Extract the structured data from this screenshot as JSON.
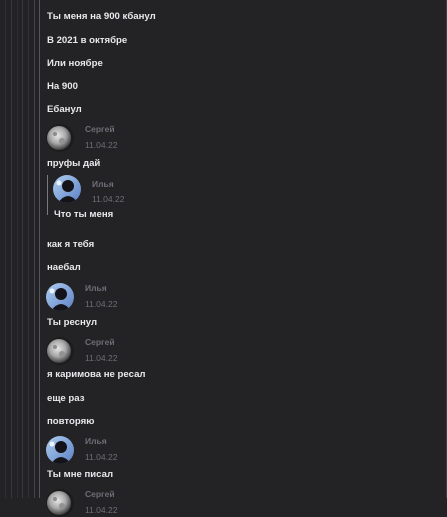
{
  "colors": {
    "background": "#232225",
    "message_text": "#e9e9ec",
    "meta_text": "#6f6e76"
  },
  "messages": [
    {
      "text": "Ты меня на 900 кбанул"
    },
    {
      "text": "В 2021 в октябре"
    },
    {
      "text": "Или ноябре"
    },
    {
      "text": "На 900"
    },
    {
      "text": "Ебанул"
    },
    {
      "author": "Сергей",
      "date": "11.04.22",
      "avatar_icon": "moon-avatar-icon"
    },
    {
      "text": "пруфы дай"
    },
    {
      "quote": {
        "author": "Илья",
        "date": "11.04.22",
        "avatar_icon": "person-avatar-icon",
        "text": "Что ты меня"
      }
    },
    {
      "text": "как я тебя"
    },
    {
      "text": "наебал"
    },
    {
      "author": "Илья",
      "date": "11.04.22",
      "avatar_icon": "person-avatar-icon"
    },
    {
      "text": "Ты реснул"
    },
    {
      "author": "Сергей",
      "date": "11.04.22",
      "avatar_icon": "moon-avatar-icon"
    },
    {
      "text": "я каримова не ресал"
    },
    {
      "text": "еще раз"
    },
    {
      "text": "повторяю"
    },
    {
      "author": "Илья",
      "date": "11.04.22",
      "avatar_icon": "person-avatar-icon"
    },
    {
      "text": "Ты мне писал"
    },
    {
      "author": "Сергей",
      "date": "11.04.22",
      "avatar_icon": "moon-avatar-icon"
    }
  ]
}
